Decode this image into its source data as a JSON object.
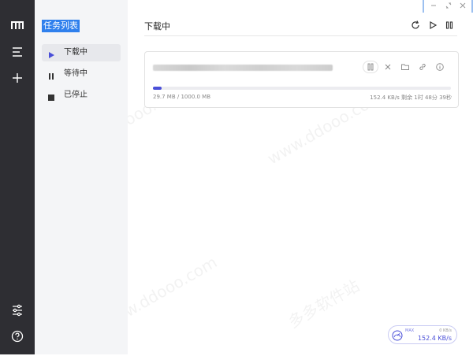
{
  "rail": {
    "icons": [
      "logo-icon",
      "menu-icon",
      "add-icon",
      "settings-sliders-icon",
      "help-icon"
    ]
  },
  "sidebar": {
    "title": "任务列表",
    "items": [
      {
        "label": "下载中",
        "icon": "play-icon"
      },
      {
        "label": "等待中",
        "icon": "pause-icon"
      },
      {
        "label": "已停止",
        "icon": "stop-icon"
      }
    ]
  },
  "header": {
    "title": "下载中",
    "buttons": [
      "refresh-icon",
      "resume-all-icon",
      "pause-all-icon"
    ]
  },
  "task": {
    "progress_fraction": 0.03,
    "size": "29.7 MB / 1000.0 MB",
    "speed": "152.4 KB/s 剩余 1时 48分 39秒",
    "actions": [
      "pause-icon",
      "close-icon",
      "folder-icon",
      "link-icon",
      "info-icon"
    ]
  },
  "speed_badge": {
    "max": "MAX",
    "upload": "0 KB/s",
    "download": "152.4 KB/s"
  },
  "watermark": "多多软件站",
  "watermark_url": "www.ddooo.com",
  "colors": {
    "rail_bg": "#2e2e33",
    "sidebar_bg": "#f4f5f7",
    "accent": "#4a4fd8",
    "title_highlight": "#2f80ed"
  }
}
